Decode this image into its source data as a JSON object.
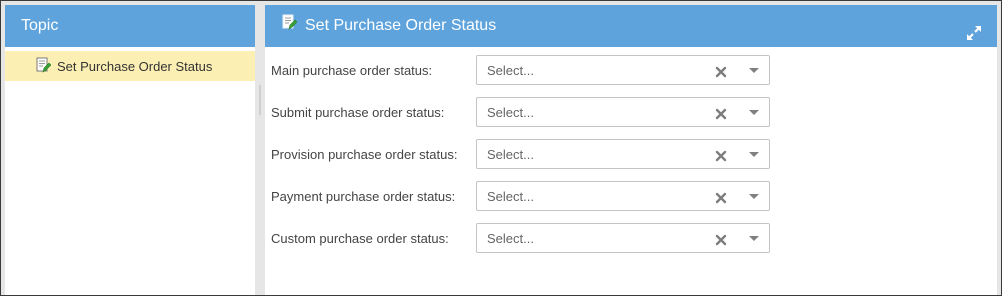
{
  "topic_panel": {
    "title": "Topic",
    "items": [
      {
        "label": "Set Purchase Order Status",
        "icon": "document-edit-icon",
        "selected": true
      }
    ]
  },
  "main_panel": {
    "title": "Set Purchase Order Status",
    "icon": "document-edit-icon",
    "expand_icon": "expand-icon",
    "fields": [
      {
        "label": "Main purchase order status:",
        "placeholder": "Select..."
      },
      {
        "label": "Submit purchase order status:",
        "placeholder": "Select..."
      },
      {
        "label": "Provision purchase order status:",
        "placeholder": "Select..."
      },
      {
        "label": "Payment purchase order status:",
        "placeholder": "Select..."
      },
      {
        "label": "Custom purchase order status:",
        "placeholder": "Select..."
      }
    ]
  },
  "colors": {
    "header_bg": "#5ea3dc",
    "selected_item_bg": "#fcefb4",
    "frame_bg": "#e6e6e6"
  }
}
